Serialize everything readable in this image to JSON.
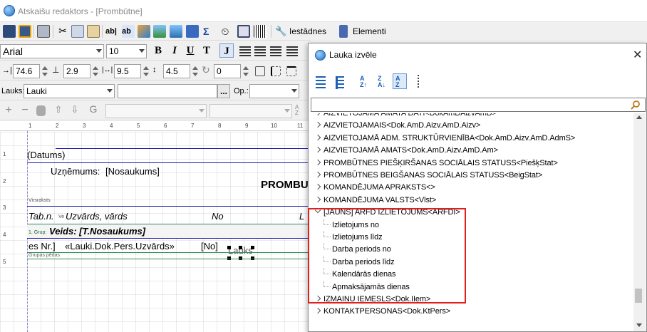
{
  "window": {
    "title": "Atskaišu redaktors - [Prombūtne]"
  },
  "toolbar1": {
    "settings_label": "Iestādnes",
    "elements_label": "Elementi"
  },
  "font": {
    "family": "Arial",
    "size": "10"
  },
  "geometry": {
    "left": "74.6",
    "top": "2.9",
    "width": "9.5",
    "height": "4.5",
    "rotation": "0"
  },
  "fieldbar": {
    "field_label": "Lauks:",
    "field_value": "Lauki",
    "op_label": "Op.:",
    "ellipsis": "..."
  },
  "ruler": {
    "ticks": [
      "1",
      "2",
      "3",
      "4",
      "5",
      "6",
      "7",
      "8",
      "9",
      "10",
      "11"
    ]
  },
  "report": {
    "rows": [
      "1",
      "2",
      "3",
      "4",
      "5"
    ],
    "datums": "(Datums)",
    "company_label": "Uzņēmums:",
    "company_value": "[Nosaukums]",
    "heading": "PROMBU",
    "band_virsraksts": "Virsraksts",
    "col_tabn": "Tab.n.",
    "col_tabn_small": "Ve",
    "col_name": "Uzvārds, vārds",
    "col_no": "No",
    "col_l": "L",
    "group_prefix": "1. Grup:",
    "group_text": "Veids: [T.Nosaukums]",
    "detail_prefix": "es Nr.]",
    "detail_field": "«Lauki.Dok.Pers.Uzvārds»",
    "detail_no": "[No]",
    "selected_field": "Lauks",
    "footer_band": "Grupas pēdas"
  },
  "dialog": {
    "title": "Lauka izvēle",
    "close": "✕",
    "search_value": "",
    "tree": [
      {
        "label": "AIZVIETOJAMĀ AMATA DATI<DokAmDAizvAmD>",
        "type": "collapsed"
      },
      {
        "label": "AIZVIETOJAMAIS<Dok.AmD.Aizv.AmD.Aizv>",
        "type": "collapsed"
      },
      {
        "label": "AIZVIETOJAMĀ ADM. STRUKTŪRVIENĪBA<Dok.AmD.Aizv.AmD.AdmS>",
        "type": "collapsed"
      },
      {
        "label": "AIZVIETOJAMĀ AMATS<Dok.AmD.Aizv.AmD.Am>",
        "type": "collapsed"
      },
      {
        "label": "PROMBŪTNES PIEŠĶIRŠANAS SOCIĀLAIS STATUSS<PiešķStat>",
        "type": "collapsed"
      },
      {
        "label": "PROMBŪTNES BEIGŠANAS SOCIĀLAIS STATUSS<BeigStat>",
        "type": "collapsed"
      },
      {
        "label": "KOMANDĒJUMA APRAKSTS<>",
        "type": "collapsed"
      },
      {
        "label": "KOMANDĒJUMA VALSTS<Vlst>",
        "type": "collapsed"
      },
      {
        "label": "[JAUNS] ARFD IZLIETOJUMS<ARFDI>",
        "type": "expanded"
      },
      {
        "label": "Izlietojums no",
        "type": "child"
      },
      {
        "label": "Izlietojums līdz",
        "type": "child"
      },
      {
        "label": "Darba periods no",
        "type": "child"
      },
      {
        "label": "Darba periods līdz",
        "type": "child"
      },
      {
        "label": "Kalendārās dienas",
        "type": "child"
      },
      {
        "label": "Apmaksājamās dienas",
        "type": "child"
      },
      {
        "label": "IZMAIŅU IEMESLS<Dok.IIem>",
        "type": "collapsed"
      },
      {
        "label": "KONTAKTPERSONAS<Dok.KtPers>",
        "type": "collapsed"
      }
    ]
  },
  "colors": {
    "highlight_box": "#e02020",
    "band_line": "#1a1aa8",
    "group_line": "#2e8b57"
  }
}
